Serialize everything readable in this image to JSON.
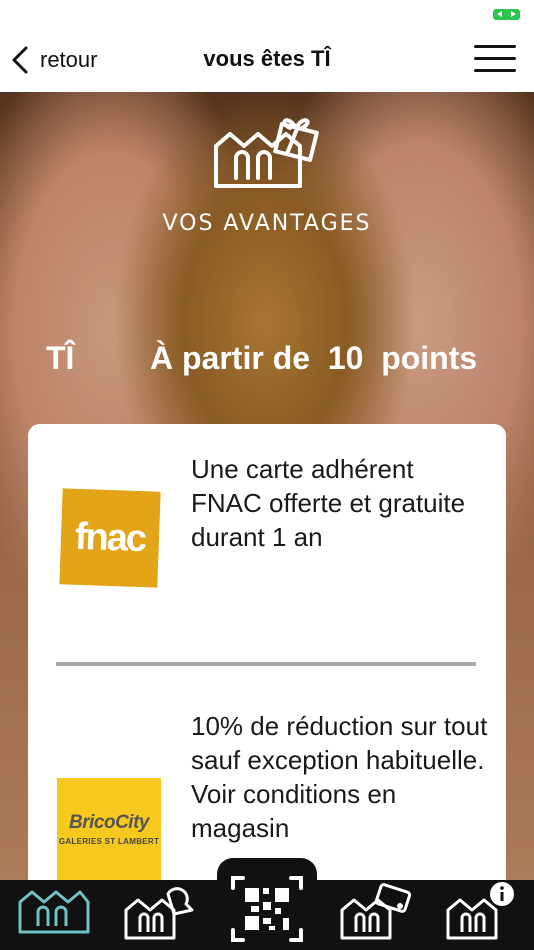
{
  "navbar": {
    "back_label": "retour",
    "title": "vous êtes TÎ"
  },
  "hero": {
    "logo_text": "VOS AVANTAGES"
  },
  "tier": {
    "name": "TÎ",
    "threshold": "À partir de  10  points"
  },
  "offers": [
    {
      "brand": "fnac",
      "description": "Une carte adhérent FNAC offerte et gratuite durant 1 an"
    },
    {
      "brand_name": "BricoCity",
      "brand_subtitle": "GALERIES ST LAMBERT",
      "description": "10% de réduction sur tout sauf exception habituelle. Voir conditions en magasin"
    }
  ],
  "tabbar": {
    "tabs": [
      "home",
      "notifications",
      "qr-scan",
      "card",
      "info"
    ]
  },
  "colors": {
    "fnac": "#e1a517",
    "brico": "#f7c91e",
    "battery": "#2ec44d",
    "tabbar": "#111111"
  }
}
